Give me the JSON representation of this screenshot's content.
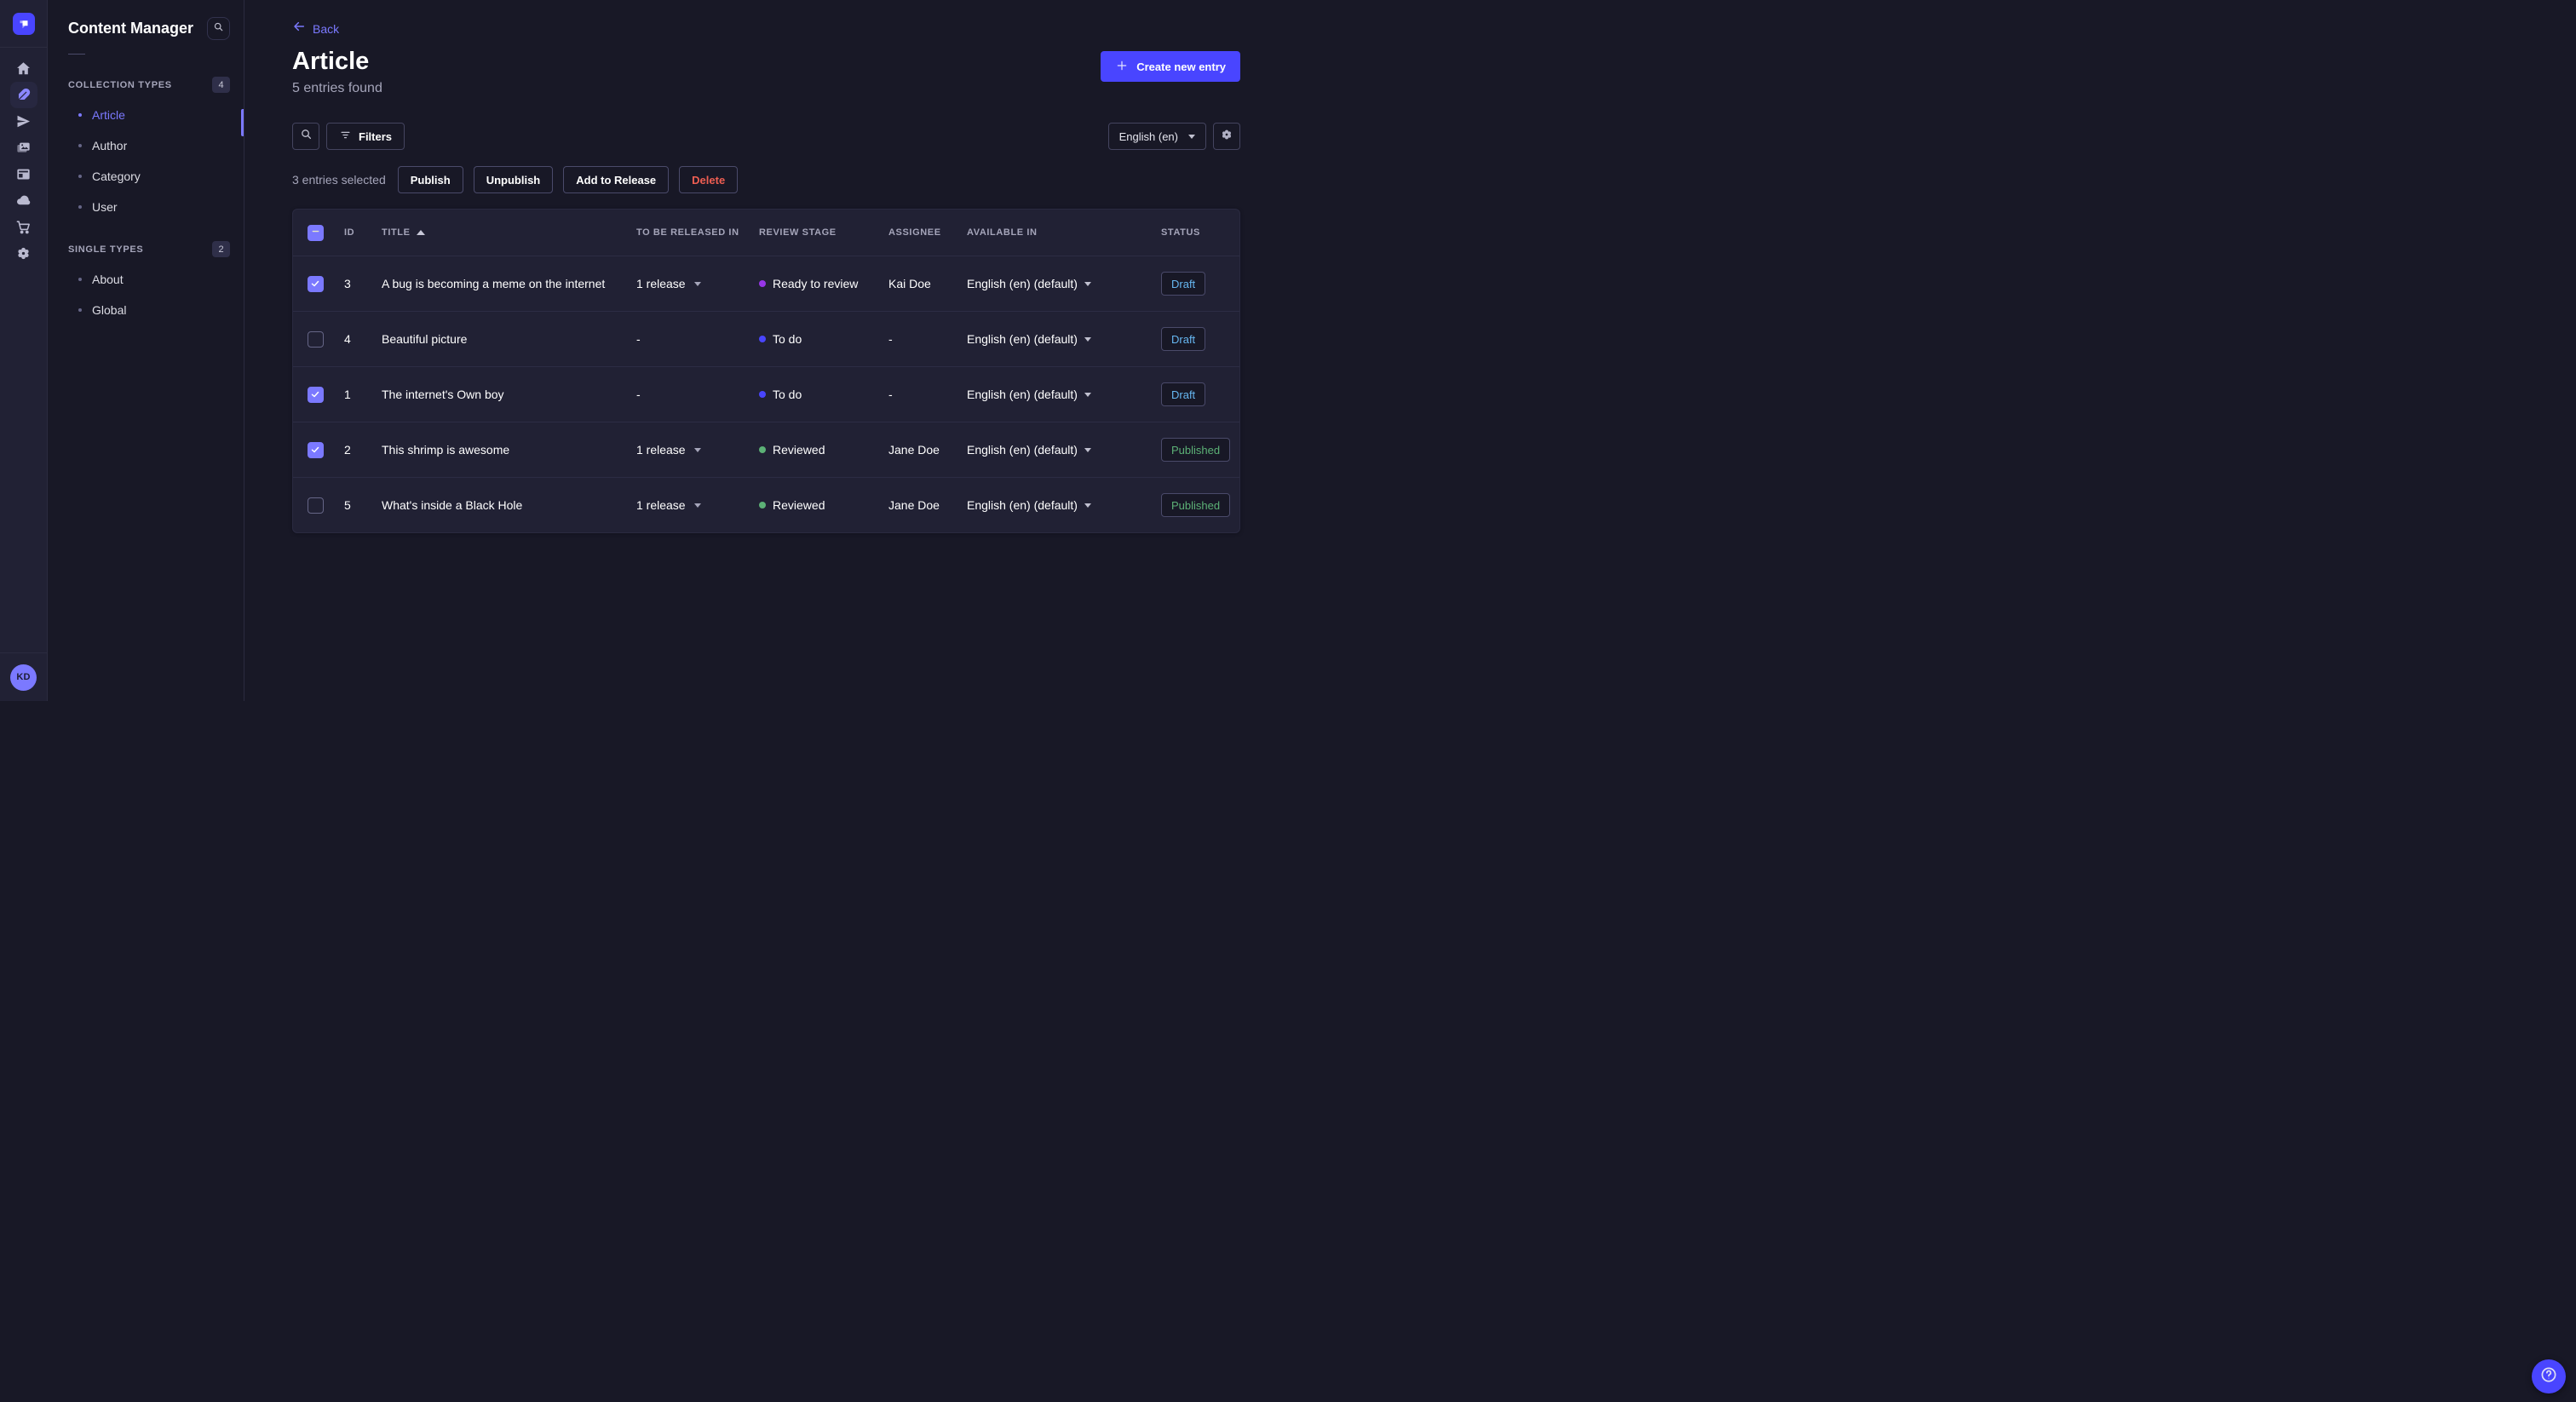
{
  "colors": {
    "accent": "#4945ff",
    "accent_light": "#7b79ff",
    "draft": "#66b7f1",
    "published": "#5cb176",
    "danger": "#ee5e52",
    "stage_todo": "#4945ff",
    "stage_ready_to_review": "#9736e8",
    "stage_reviewed": "#5cb176"
  },
  "nav": {
    "icons": [
      "strapi-logo",
      "home",
      "content-manager-feather",
      "send",
      "media-library",
      "content-type-builder",
      "cloud",
      "marketplace-cart",
      "settings-gear"
    ],
    "active": "content-manager-feather"
  },
  "user": {
    "initials": "KD"
  },
  "sidebar": {
    "title": "Content Manager",
    "sections": [
      {
        "label": "COLLECTION TYPES",
        "badge": "4",
        "items": [
          {
            "label": "Article",
            "active": true
          },
          {
            "label": "Author",
            "active": false
          },
          {
            "label": "Category",
            "active": false
          },
          {
            "label": "User",
            "active": false
          }
        ]
      },
      {
        "label": "SINGLE TYPES",
        "badge": "2",
        "items": [
          {
            "label": "About",
            "active": false
          },
          {
            "label": "Global",
            "active": false
          }
        ]
      }
    ]
  },
  "header": {
    "back_label": "Back",
    "title": "Article",
    "subtitle": "5 entries found",
    "create_label": "Create new entry"
  },
  "toolbar": {
    "filters_label": "Filters",
    "locale": "English (en)"
  },
  "selection": {
    "text": "3 entries selected",
    "actions": [
      "Publish",
      "Unpublish",
      "Add to Release",
      "Delete"
    ]
  },
  "table": {
    "select_all_state": "indeterminate",
    "sort": {
      "column": "TITLE",
      "direction": "asc"
    },
    "columns": [
      "ID",
      "TITLE",
      "TO BE RELEASED IN",
      "REVIEW STAGE",
      "ASSIGNEE",
      "AVAILABLE IN",
      "STATUS"
    ],
    "rows": [
      {
        "checked": true,
        "id": "3",
        "title": "A bug is becoming a meme on the internet",
        "release": "1 release",
        "stage": "Ready to review",
        "assignee": "Kai Doe",
        "locale": "English (en) (default)",
        "status": "Draft"
      },
      {
        "checked": false,
        "id": "4",
        "title": "Beautiful picture",
        "release": "-",
        "stage": "To do",
        "assignee": "-",
        "locale": "English (en) (default)",
        "status": "Draft"
      },
      {
        "checked": true,
        "id": "1",
        "title": "The internet's Own boy",
        "release": "-",
        "stage": "To do",
        "assignee": "-",
        "locale": "English (en) (default)",
        "status": "Draft"
      },
      {
        "checked": true,
        "id": "2",
        "title": "This shrimp is awesome",
        "release": "1 release",
        "stage": "Reviewed",
        "assignee": "Jane Doe",
        "locale": "English (en) (default)",
        "status": "Published"
      },
      {
        "checked": false,
        "id": "5",
        "title": "What's inside a Black Hole",
        "release": "1 release",
        "stage": "Reviewed",
        "assignee": "Jane Doe",
        "locale": "English (en) (default)",
        "status": "Published"
      }
    ]
  }
}
